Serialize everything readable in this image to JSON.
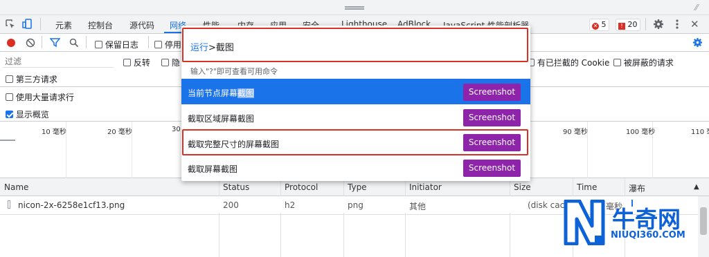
{
  "tabs": [
    "元素",
    "控制台",
    "源代码",
    "网络",
    "性能",
    "内存",
    "应用",
    "安全",
    "Lighthouse",
    "AdBlock",
    "JavaScript 性能剖析器"
  ],
  "badges": {
    "errors": "5",
    "warnings": "20"
  },
  "toolbar": {
    "preserve_log": "保留日志",
    "disable_cache": "停用"
  },
  "filter": {
    "placeholder": "过滤",
    "invert": "反转",
    "hide": "隐",
    "blocked_cookies": "有已拦截的 Cookie",
    "blocked_requests": "被屏蔽的请求",
    "third_party": "第三方请求",
    "big_rows": "使用大量请求行",
    "overview": "显示概览"
  },
  "timeline": {
    "ticks": [
      "10 毫秒",
      "20 毫秒",
      "30",
      "90 毫秒",
      "100 毫秒",
      "110 毫"
    ]
  },
  "columns": [
    "Name",
    "Status",
    "Protocol",
    "Type",
    "Initiator",
    "Size",
    "Time",
    "瀑布"
  ],
  "row": {
    "name": "nicon-2x-6258e1cf13.png",
    "status": "200",
    "protocol": "h2",
    "type": "png",
    "initiator": "其他",
    "size": "(disk cache)",
    "time": "毫秒"
  },
  "palette": {
    "prefix": "运行",
    "query": ">截图",
    "hint": "输入\"?\"即可查看可用命令",
    "items": [
      {
        "label_pre": "当前节点屏幕",
        "label_hl": "截图",
        "button": "Screenshot"
      },
      {
        "label": "截取区域屏幕截图",
        "button": "Screenshot"
      },
      {
        "label": "截取完整尺寸的屏幕截图",
        "button": "Screenshot"
      },
      {
        "label": "截取屏幕截图",
        "button": "Screenshot"
      }
    ]
  },
  "watermark": {
    "brand": "牛奇网",
    "url": "NIUQI360.COM"
  },
  "colors": {
    "accent": "#1a73e8",
    "screenshot_button": "#8e24aa",
    "highlight_box": "#d93025",
    "brand": "#0d62d8"
  }
}
